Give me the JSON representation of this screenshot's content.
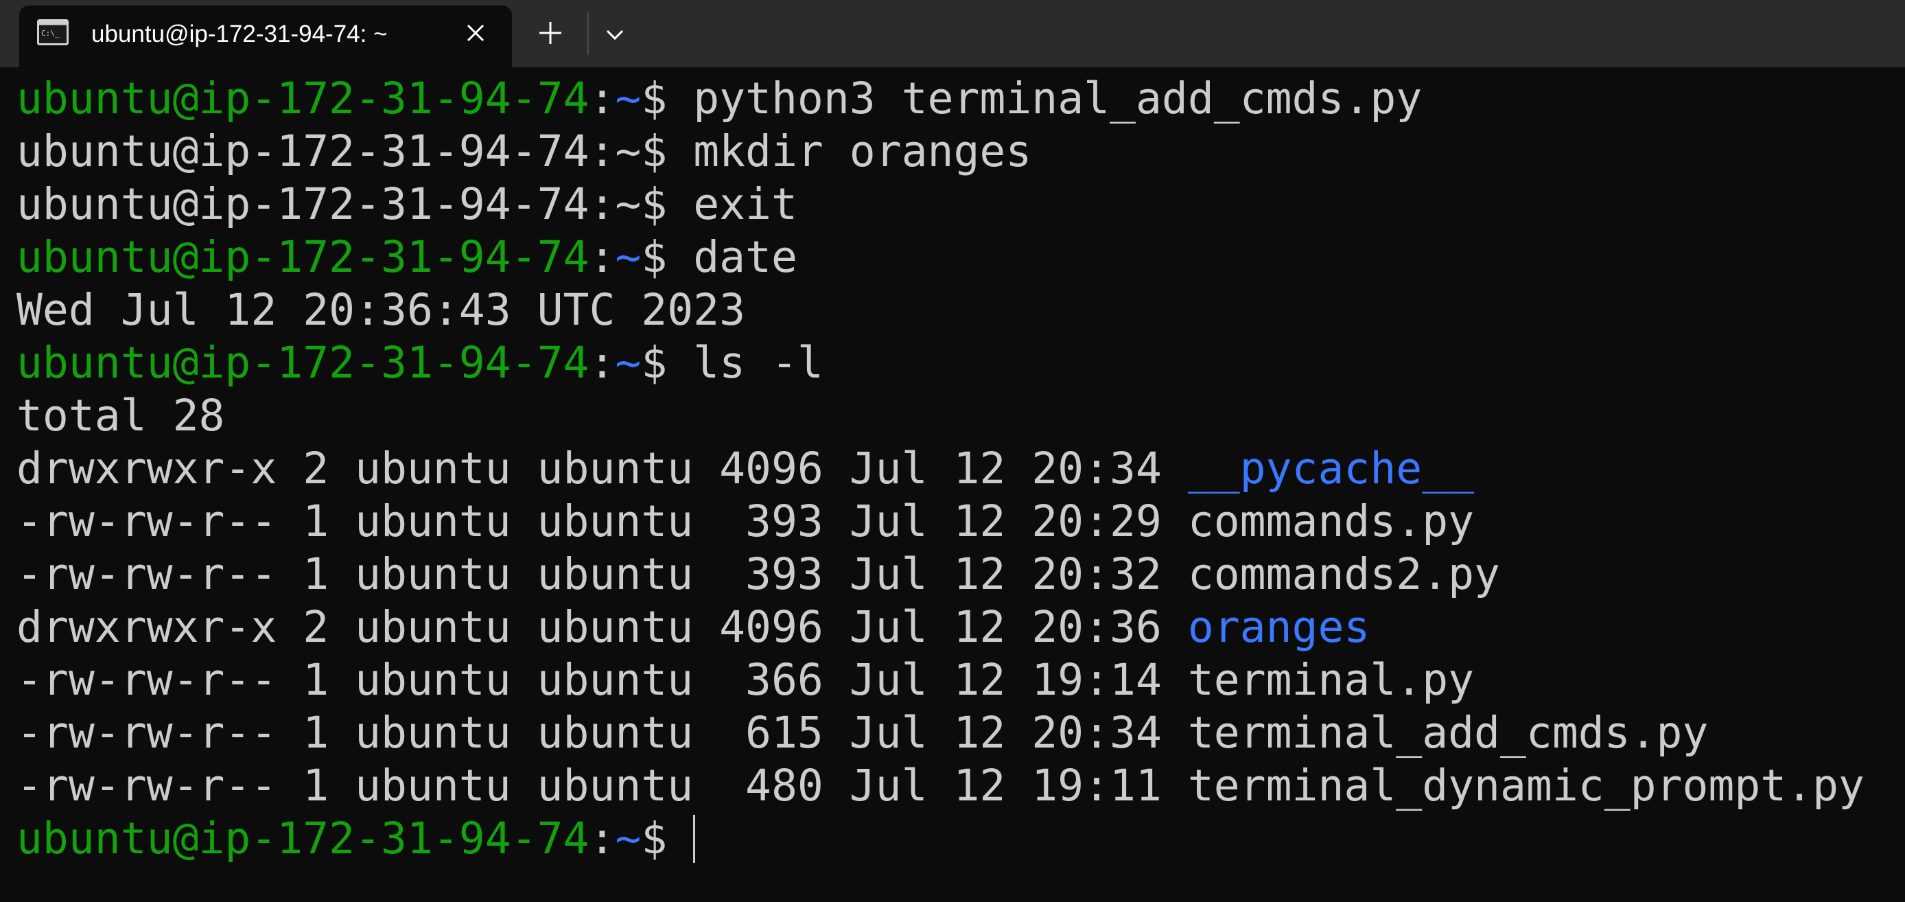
{
  "window": {
    "tab_title": "ubuntu@ip-172-31-94-74: ~",
    "tab_icon": "terminal-icon",
    "close_icon": "close-icon",
    "new_tab_icon": "plus-icon",
    "dropdown_icon": "chevron-down-icon"
  },
  "colors": {
    "background": "#0c0c0c",
    "titlebar": "#2b2b2b",
    "text": "#cccccc",
    "user_host": "#13a10e",
    "path_and_dirs": "#3b78ff"
  },
  "prompt": {
    "user_host": "ubuntu@ip-172-31-94-74",
    "colon": ":",
    "path": "~",
    "symbol": "$ "
  },
  "lines": [
    {
      "type": "prompt",
      "colored": true,
      "command": "python3 terminal_add_cmds.py"
    },
    {
      "type": "prompt",
      "colored": false,
      "command": "mkdir oranges"
    },
    {
      "type": "prompt",
      "colored": false,
      "command": "exit"
    },
    {
      "type": "prompt",
      "colored": true,
      "command": "date"
    },
    {
      "type": "output",
      "text": "Wed Jul 12 20:36:43 UTC 2023"
    },
    {
      "type": "prompt",
      "colored": true,
      "command": "ls -l"
    },
    {
      "type": "output",
      "text": "total 28"
    },
    {
      "type": "listing",
      "meta": "drwxrwxr-x 2 ubuntu ubuntu 4096 Jul 12 20:34 ",
      "name": "__pycache__",
      "is_dir": true
    },
    {
      "type": "listing",
      "meta": "-rw-rw-r-- 1 ubuntu ubuntu  393 Jul 12 20:29 ",
      "name": "commands.py",
      "is_dir": false
    },
    {
      "type": "listing",
      "meta": "-rw-rw-r-- 1 ubuntu ubuntu  393 Jul 12 20:32 ",
      "name": "commands2.py",
      "is_dir": false
    },
    {
      "type": "listing",
      "meta": "drwxrwxr-x 2 ubuntu ubuntu 4096 Jul 12 20:36 ",
      "name": "oranges",
      "is_dir": true
    },
    {
      "type": "listing",
      "meta": "-rw-rw-r-- 1 ubuntu ubuntu  366 Jul 12 19:14 ",
      "name": "terminal.py",
      "is_dir": false
    },
    {
      "type": "listing",
      "meta": "-rw-rw-r-- 1 ubuntu ubuntu  615 Jul 12 20:34 ",
      "name": "terminal_add_cmds.py",
      "is_dir": false
    },
    {
      "type": "listing",
      "meta": "-rw-rw-r-- 1 ubuntu ubuntu  480 Jul 12 19:11 ",
      "name": "terminal_dynamic_prompt.py",
      "is_dir": false
    },
    {
      "type": "prompt",
      "colored": true,
      "command": "",
      "cursor": true
    }
  ]
}
